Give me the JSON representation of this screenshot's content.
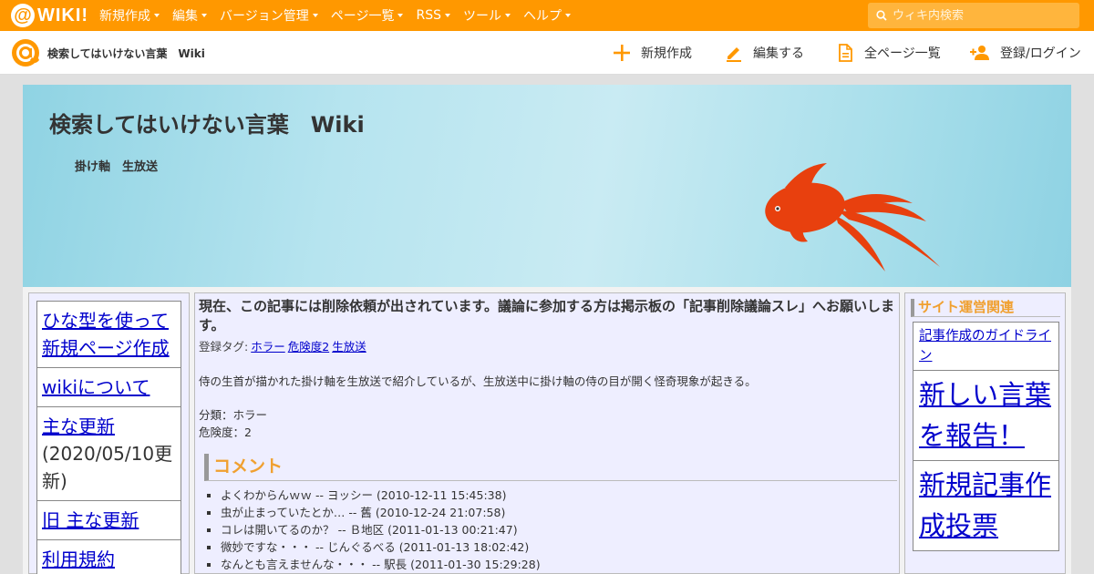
{
  "topbar": {
    "logo_text": "WIKI!",
    "nav": [
      "新規作成",
      "編集",
      "バージョン管理",
      "ページ一覧",
      "RSS",
      "ツール",
      "ヘルプ"
    ],
    "search_placeholder": "ウィキ内検索"
  },
  "subbar": {
    "site_title": "検索してはいけない言葉　Wiki",
    "actions": {
      "new": "新規作成",
      "edit": "編集する",
      "all_pages": "全ページ一覧",
      "login": "登録/ログイン"
    }
  },
  "banner": {
    "title": "検索してはいけない言葉　Wiki",
    "subtitle": "掛け軸　生放送"
  },
  "sidebar": {
    "items": [
      {
        "label": "ひな型を使って新規ページ作成"
      },
      {
        "label": "wikiについて"
      },
      {
        "label": "主な更新",
        "note": "(2020/05/10更新)"
      },
      {
        "label": "旧 主な更新"
      },
      {
        "label": "利用規約"
      }
    ]
  },
  "article": {
    "notice": "現在、この記事には削除依頼が出されています。議論に参加する方は掲示板の「記事削除議論スレ」へお願いします。",
    "tags_label": "登録タグ:",
    "tags": [
      "ホラー",
      "危険度2",
      "生放送"
    ],
    "body": "侍の生首が描かれた掛け軸を生放送で紹介しているが、生放送中に掛け軸の侍の目が開く怪奇現象が起きる。",
    "category": "分類：ホラー",
    "danger": "危険度：2",
    "comment_heading": "コメント",
    "comments": [
      "よくわからんｗｗ -- ヨッシー (2010-12-11 15:45:38)",
      "虫が止まっていたとか… -- 舊 (2010-12-24 21:07:58)",
      "コレは開いてるのか？ -- Ｂ地区 (2011-01-13 00:21:47)",
      "微妙ですな・・・ -- じんぐるべる (2011-01-13 18:02:42)",
      "なんとも言えませんな・・・ -- 駅長 (2011-01-30 15:29:28)"
    ]
  },
  "rightbar": {
    "heading": "サイト運営関連",
    "links": [
      {
        "label": "記事作成のガイドライン",
        "size": "small"
      },
      {
        "label": "新しい言葉を報告！",
        "size": "big"
      },
      {
        "label": "新規記事作成投票",
        "size": "big"
      }
    ]
  },
  "colors": {
    "brand": "#ff9800",
    "heading_accent": "#f0a030",
    "link": "#0000cc",
    "fish": "#e8400e"
  },
  "icons": [
    "search-icon",
    "plus-icon",
    "pencil-icon",
    "document-icon",
    "user-add-icon",
    "atwiki-logo-icon",
    "goldfish-illustration"
  ]
}
